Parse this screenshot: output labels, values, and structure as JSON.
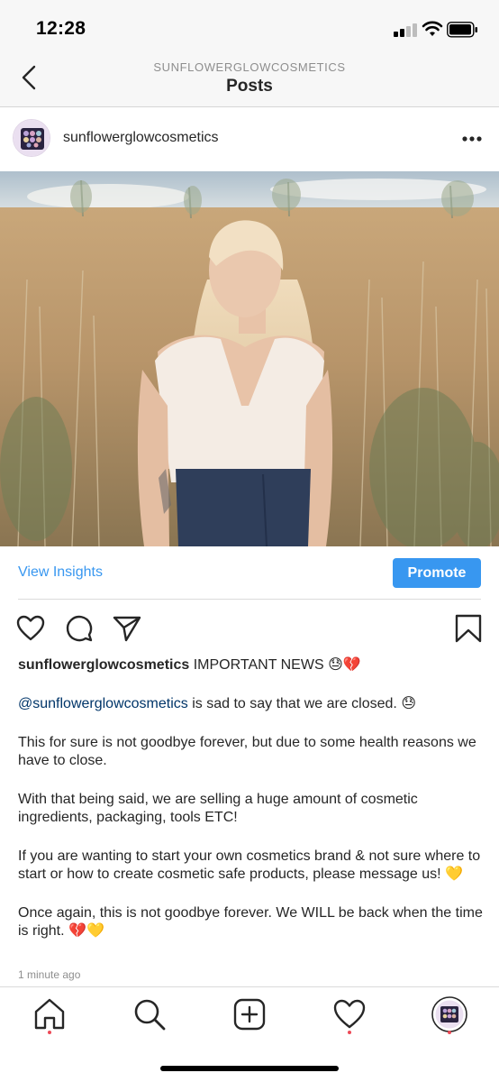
{
  "status_bar": {
    "time": "12:28"
  },
  "nav": {
    "account_label": "SUNFLOWERGLOWCOSMETICS",
    "title": "Posts"
  },
  "post": {
    "username": "sunflowerglowcosmetics",
    "insights_label": "View Insights",
    "promote_label": "Promote",
    "caption": {
      "username": "sunflowerglowcosmetics",
      "headline": "IMPORTANT NEWS 😓💔",
      "mention": "@sunflowerglowcosmetics",
      "line1_rest": " is sad to say that we are closed. 😓",
      "para2": "This for sure is not goodbye forever, but due to some health reasons we have to close.",
      "para3": "With that being said, we are selling a huge amount of cosmetic ingredients, packaging, tools ETC!",
      "para4": "If you are wanting to start your own cosmetics brand & not sure where to start or how to create cosmetic safe products, please message us! 💛",
      "para5": "Once again, this is not goodbye forever. We WILL be back when the time is right. 💔💛"
    },
    "timestamp": "1 minute ago"
  },
  "colors": {
    "accent_blue": "#3897f0",
    "mention_blue": "#003569",
    "notification_red": "#ed4956"
  },
  "icons": {
    "back": "chevron-left-icon",
    "more": "more-horizontal-icon",
    "like": "heart-icon",
    "comment": "comment-icon",
    "share": "paper-plane-icon",
    "save": "bookmark-icon",
    "tabs": [
      "home-icon",
      "search-icon",
      "add-post-icon",
      "activity-heart-icon",
      "profile-avatar-icon"
    ]
  }
}
